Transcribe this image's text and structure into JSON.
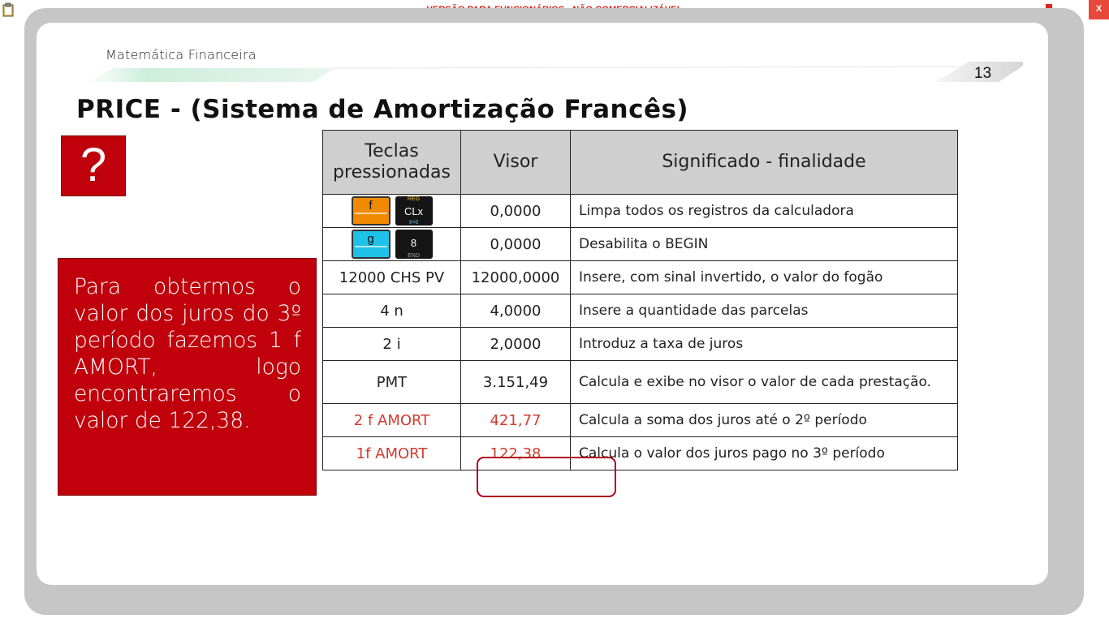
{
  "app": {
    "banner": "VERSÃO PARA FUNCIONÁRIOS - NÃO COMERCIALIZÁVEL",
    "close_label": "X",
    "icons": [
      "clipboard-icon",
      "network-icon"
    ]
  },
  "slide": {
    "course_title": "Matemática Financeira",
    "page_number": "13",
    "title": "PRICE - (Sistema de Amortização Francês)",
    "question_mark": "?",
    "note": "Para obtermos o valor dos juros do 3º período fazemos 1 f AMORT, logo encontraremos o valor de 122,38."
  },
  "table": {
    "headers": [
      "Teclas pressionadas",
      "Visor",
      "Significado - finalidade"
    ],
    "keys": {
      "f_label": "f",
      "clx_top": "REG",
      "clx_label": "CLx",
      "clx_bottom": "x̄=0",
      "g_label": "g",
      "eight_label": "8",
      "eight_bottom": "END"
    },
    "rows": [
      {
        "keys": "",
        "visor": "0,0000",
        "desc": "Limpa todos os registros da calculadora"
      },
      {
        "keys": "",
        "visor": "0,0000",
        "desc": "Desabilita o BEGIN"
      },
      {
        "keys": "12000 CHS PV",
        "visor": "12000,0000",
        "desc": "Insere, com sinal invertido, o valor do fogão"
      },
      {
        "keys": "4 n",
        "visor": "4,0000",
        "desc": "Insere a quantidade das parcelas"
      },
      {
        "keys": "2 i",
        "visor": "2,0000",
        "desc": "Introduz a taxa de juros"
      },
      {
        "keys": "PMT",
        "visor": "3.151,49",
        "desc": "Calcula e exibe no visor o valor de cada prestação."
      },
      {
        "keys": "2 f AMORT",
        "visor": "421,77",
        "desc": "Calcula a soma dos juros até o 2º período"
      },
      {
        "keys": "1f AMORT",
        "visor": "122,38",
        "desc": "Calcula o valor dos juros pago no 3º período"
      }
    ]
  },
  "colors": {
    "accent_red": "#c0000b",
    "red_text": "#d23b2e",
    "frame_gray": "#c6c6c6",
    "header_gray": "#cfcfcf",
    "deco_green": "#c6ead7"
  }
}
